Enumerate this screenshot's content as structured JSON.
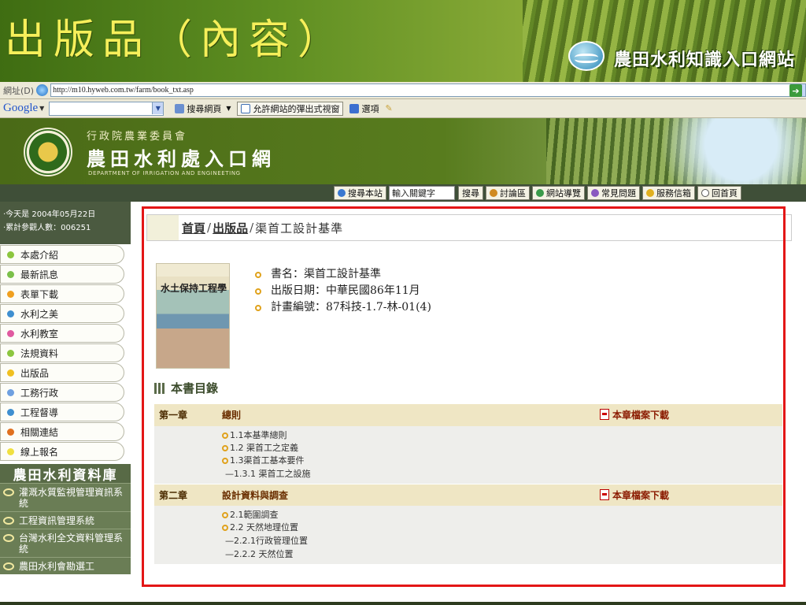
{
  "slide": {
    "title": "出版品（內容）",
    "brand": "農田水利知識入口網站"
  },
  "browser": {
    "address_label": "網址(D)",
    "url": "http://m10.hyweb.com.tw/farm/book_txt.asp",
    "google_logo": "Google",
    "toolbar": {
      "search_web": "搜尋網頁",
      "allow_popups": "允許網站的彈出式視窗",
      "options": "選項"
    }
  },
  "site": {
    "council": "行政院農業委員會",
    "dept_name": "農田水利處入口網",
    "dept_en": "DEPARTMENT OF IRRIGATION AND ENGINEETING",
    "nav": {
      "search_site": "搜尋本站",
      "keyword_placeholder": "輸入關鍵字",
      "search_btn": "搜尋",
      "items": [
        "討論區",
        "網站導覽",
        "常見問題",
        "服務信箱",
        "回首頁"
      ]
    }
  },
  "sidebar": {
    "today": "‧今天是 2004年05月22日",
    "visitors": "‧累計參觀人數：006251",
    "items": [
      {
        "label": "本處介紹",
        "color": "#8cc63f"
      },
      {
        "label": "最新訊息",
        "color": "#7bc04a"
      },
      {
        "label": "表單下載",
        "color": "#f0a020"
      },
      {
        "label": "水利之美",
        "color": "#3f8fd0"
      },
      {
        "label": "水利教室",
        "color": "#e05aa0"
      },
      {
        "label": "法規資料",
        "color": "#8cc63f"
      },
      {
        "label": "出版品",
        "color": "#f0c020"
      },
      {
        "label": "工務行政",
        "color": "#6fa0e0"
      },
      {
        "label": "工程督導",
        "color": "#3f8fd0"
      },
      {
        "label": "相關連結",
        "color": "#e07020"
      },
      {
        "label": "線上報名",
        "color": "#f0e040"
      }
    ],
    "db_title": "農田水利資料庫",
    "db_items": [
      "灌溉水質監視管理資訊系統",
      "工程資訊管理系統",
      "台灣水利全文資料管理系統",
      "農田水利會勘選工"
    ]
  },
  "main": {
    "breadcrumb": {
      "home": "首頁",
      "section": "出版品",
      "current": "渠首工設計基準",
      "sep": "/"
    },
    "book": {
      "cover_title": "水土保持工程學",
      "name": "書名：渠首工設計基準",
      "date": "出版日期：中華民國86年11月",
      "plan": "計畫編號：87科技-1.7-林-01(4)"
    },
    "toc_title": "本書目錄",
    "download_label": "本章檔案下載",
    "chapters": [
      {
        "num": "第一章",
        "title": "總則",
        "sections": [
          "1.1本基準總則",
          "1.2 渠首工之定義",
          "1.3渠首工基本要件"
        ],
        "subsections": [
          "—1.3.1 渠首工之設施"
        ]
      },
      {
        "num": "第二章",
        "title": "設計資料與調查",
        "sections": [
          "2.1範圍調查",
          "2.2 天然地理位置"
        ],
        "subsections": [
          "—2.2.1行政管理位置",
          "—2.2.2 天然位置"
        ]
      }
    ]
  }
}
